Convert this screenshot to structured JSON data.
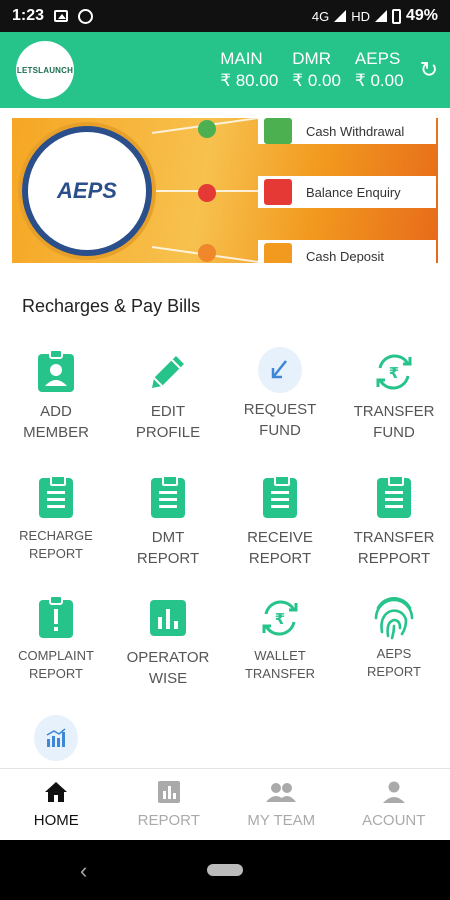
{
  "status_bar": {
    "time": "1:23",
    "network": "4G",
    "hd": "HD",
    "battery": "49%"
  },
  "header": {
    "logo_text": "LETSLAUNCH",
    "wallets": [
      {
        "label": "MAIN",
        "value": "₹ 80.00"
      },
      {
        "label": "DMR",
        "value": "₹ 0.00"
      },
      {
        "label": "AEPS",
        "value": "₹ 0.00"
      }
    ],
    "refresh_icon": "refresh-icon"
  },
  "banner": {
    "logo_text": "AEPS",
    "services": [
      "Cash Withdrawal",
      "Balance Enquiry",
      "Cash Deposit"
    ],
    "colors": {
      "green": "#4caf50",
      "red": "#e53935",
      "orange": "#f29a1f"
    }
  },
  "section_title": "Recharges & Pay Bills",
  "tiles": [
    {
      "line1": "ADD",
      "line2": "MEMBER",
      "icon": "add-member-icon"
    },
    {
      "line1": "EDIT",
      "line2": "PROFILE",
      "icon": "edit-icon"
    },
    {
      "line1": "REQUEST",
      "line2": "FUND",
      "icon": "request-fund-icon"
    },
    {
      "line1": "TRANSFER",
      "line2": "FUND",
      "icon": "rupee-transfer-icon"
    },
    {
      "line1": "RECHARGE",
      "line2": "REPORT",
      "icon": "report-icon"
    },
    {
      "line1": "DMT",
      "line2": "REPORT",
      "icon": "report-icon"
    },
    {
      "line1": "RECEIVE",
      "line2": "REPORT",
      "icon": "report-icon"
    },
    {
      "line1": "TRANSFER",
      "line2": "REPPORT",
      "icon": "report-icon"
    },
    {
      "line1": "COMPLAINT",
      "line2": "REPORT",
      "icon": "complaint-icon"
    },
    {
      "line1": "OPERATOR",
      "line2": "WISE",
      "icon": "bar-chart-icon"
    },
    {
      "line1": "WALLET",
      "line2": "TRANSFER",
      "icon": "rupee-transfer-icon"
    },
    {
      "line1": "AEPS",
      "line2": "REPORT",
      "icon": "fingerprint-icon"
    }
  ],
  "bottom_nav": [
    {
      "label": "HOME",
      "active": true
    },
    {
      "label": "REPORT",
      "active": false
    },
    {
      "label": "MY TEAM",
      "active": false
    },
    {
      "label": "ACOUNT",
      "active": false
    }
  ],
  "accent_color": "#26c38b"
}
